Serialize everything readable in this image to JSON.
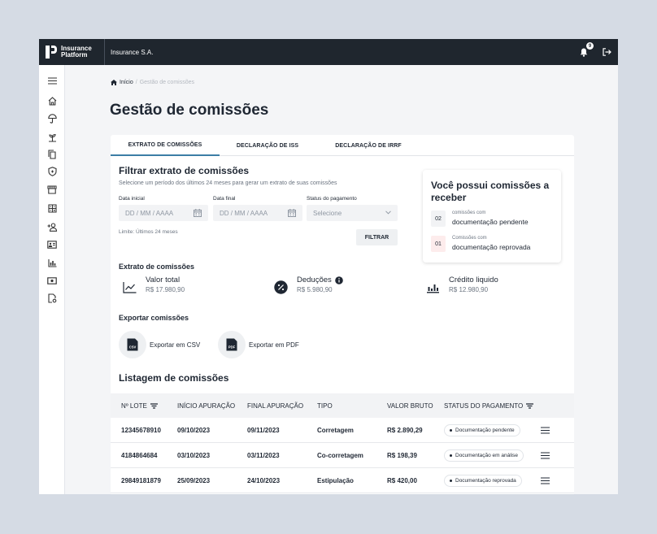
{
  "app": {
    "logo_line1": "Insurance",
    "logo_line2": "Platform",
    "company": "Insurance S.A.",
    "notification_count": "9"
  },
  "sidebar": {
    "items": [
      "menu-icon",
      "home-icon",
      "umbrella-icon",
      "plant-icon",
      "documents-icon",
      "shield-icon",
      "store-icon",
      "calculator-icon",
      "add-user-icon",
      "id-card-icon",
      "bar-chart-icon",
      "money-icon",
      "file-settings-icon"
    ]
  },
  "breadcrumb": {
    "home": "Início",
    "separator": "/",
    "current": "Gestão de comissões"
  },
  "page_title": "Gestão de comissões",
  "tabs": [
    {
      "label": "EXTRATO DE COMISSÕES",
      "active": true
    },
    {
      "label": "DECLARAÇÃO DE ISS",
      "active": false
    },
    {
      "label": "DECLARAÇÃO DE IRRF",
      "active": false
    }
  ],
  "filter": {
    "title": "Filtrar extrato de comissões",
    "description": "Selecione um período dos últimos 24 meses para gerar um extrato de suas comissões",
    "start_label": "Data inicial",
    "start_placeholder": "DD / MM / AAAA",
    "end_label": "Data final",
    "end_placeholder": "DD / MM / AAAA",
    "status_label": "Status do pagamento",
    "status_value": "Selecione",
    "limit_text": "Limite: Últimos 24 meses",
    "button": "FILTRAR"
  },
  "notice": {
    "title": "Você possui comissões a receber",
    "items": [
      {
        "count": "02",
        "small": "comissões com",
        "label": "documentação pendente",
        "color": "#f2f3f5"
      },
      {
        "count": "01",
        "small": "Comissões com",
        "label": "documentação reprovada",
        "color": "#fdecec"
      }
    ]
  },
  "statement": {
    "title": "Extrato de comissões",
    "stats": [
      {
        "label": "Valor total",
        "value": "R$ 17.980,90",
        "icon": "line-chart-icon"
      },
      {
        "label": "Deduções",
        "value": "R$ 5.980,90",
        "icon": "percent-icon"
      },
      {
        "label": "Crédito liquido",
        "value": "R$ 12.980,90",
        "icon": "bar-chart-icon"
      }
    ]
  },
  "export": {
    "title": "Exportar comissões",
    "csv": "Exportar em CSV",
    "csv_tag": "CSV",
    "pdf": "Exportar em PDF",
    "pdf_tag": "PDF"
  },
  "listing": {
    "title": "Listagem de comissões",
    "columns": [
      "Nº LOTE",
      "INÍCIO APURAÇÃO",
      "FINAL APURAÇÃO",
      "TIPO",
      "VALOR BRUTO",
      "STATUS DO PAGAMENTO"
    ],
    "rows": [
      {
        "lote": "12345678910",
        "inicio": "09/10/2023",
        "final": "09/11/2023",
        "tipo": "Corretagem",
        "valor": "R$ 2.890,29",
        "status": "Documentação pendente"
      },
      {
        "lote": "4184864684",
        "inicio": "03/10/2023",
        "final": "03/11/2023",
        "tipo": "Co-corretagem",
        "valor": "R$ 198,39",
        "status": "Documentação em análise"
      },
      {
        "lote": "29849181879",
        "inicio": "25/09/2023",
        "final": "24/10/2023",
        "tipo": "Estipulação",
        "valor": "R$ 420,00",
        "status": "Documentação reprovada"
      }
    ]
  },
  "colors": {
    "accent": "#3c7ea6",
    "topbar": "#1f262e"
  }
}
